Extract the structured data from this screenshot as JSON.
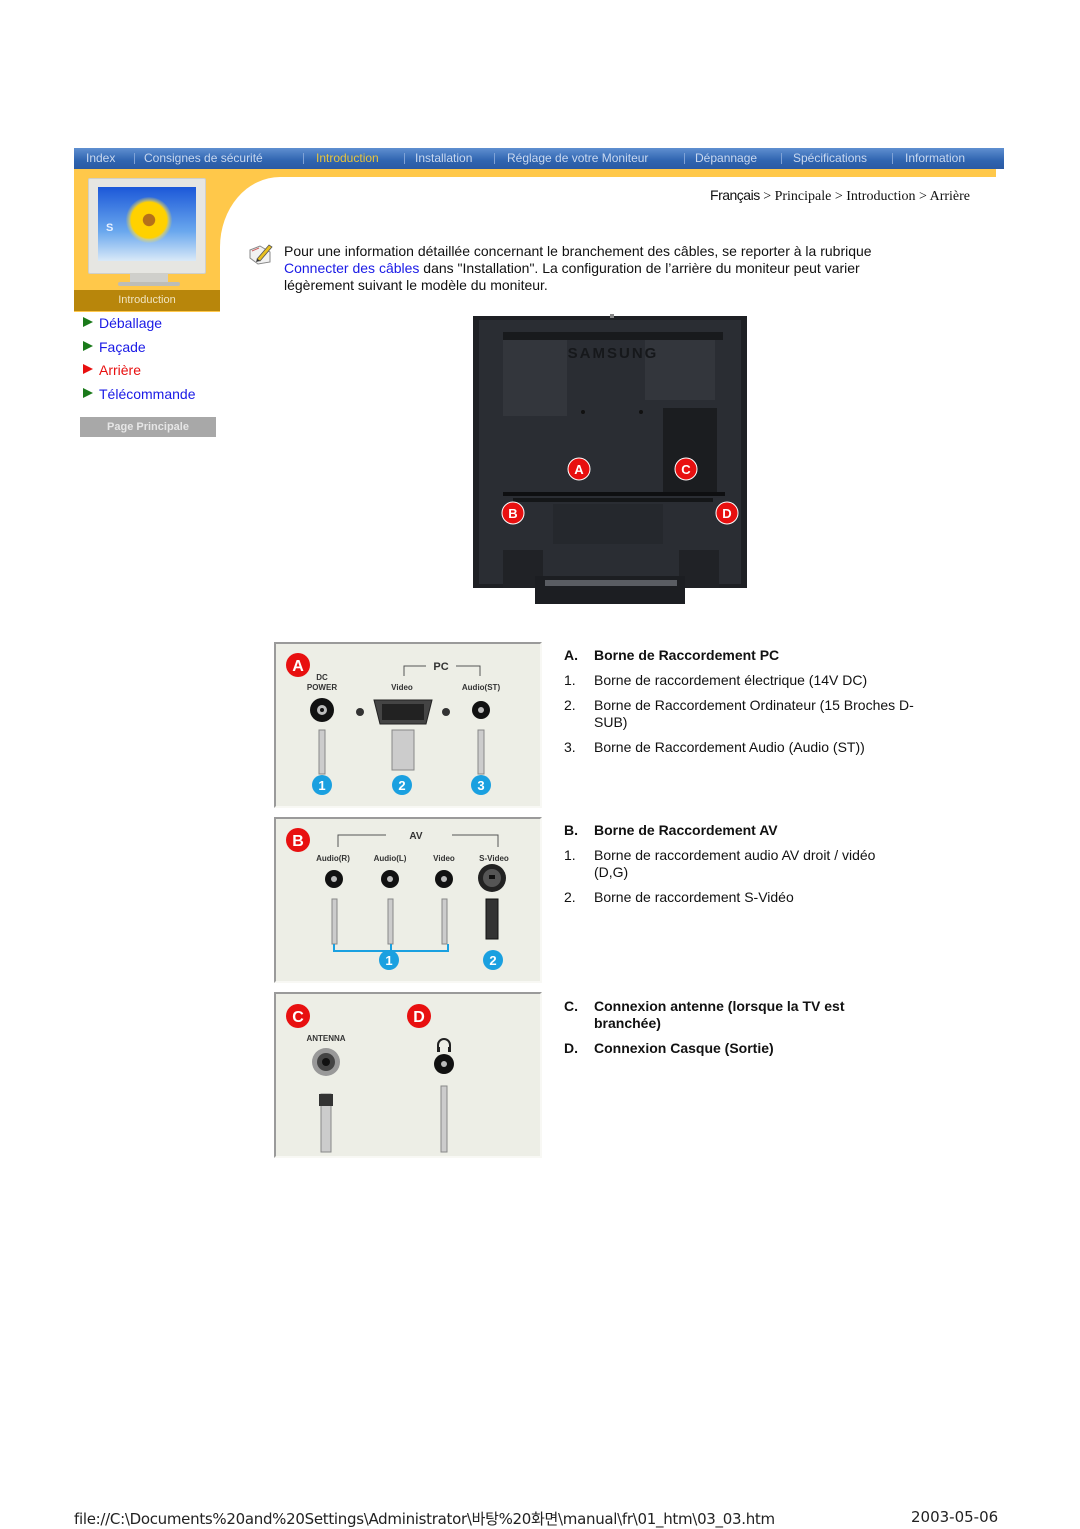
{
  "nav": {
    "items": [
      {
        "label": "Index",
        "active": false
      },
      {
        "label": "Consignes de sécurité",
        "active": false
      },
      {
        "label": "Introduction",
        "active": true
      },
      {
        "label": "Installation",
        "active": false
      },
      {
        "label": "Réglage de votre Moniteur",
        "active": false
      },
      {
        "label": "Dépannage",
        "active": false
      },
      {
        "label": "Spécifications",
        "active": false
      },
      {
        "label": "Information",
        "active": false
      }
    ],
    "colors": {
      "bar": "#2f64b0",
      "text": "#c9d8ef",
      "active_text": "#e8c43a",
      "strip": "#ffc84a"
    }
  },
  "sidebar": {
    "section_label": "Introduction",
    "monitor_screen_letter": "S",
    "items": [
      {
        "label": "Déballage",
        "active": false
      },
      {
        "label": "Façade",
        "active": false
      },
      {
        "label": "Arrière",
        "active": true
      },
      {
        "label": "Télécommande",
        "active": false
      }
    ],
    "home_button": "Page Principale"
  },
  "breadcrumb": {
    "first": "Français",
    "rest": " > Principale > Introduction > Arrière"
  },
  "note": {
    "icon": "note-pencil-icon",
    "text_before": "Pour une information détaillée concernant le branchement des câbles, se reporter à la rubrique ",
    "link": "Connecter des câbles",
    "text_after": " dans \"Installation\". La configuration de l’arrière du moniteur peut varier légèrement suivant le modèle du moniteur."
  },
  "rear_photo": {
    "brand": "SAMSUNG",
    "markers": [
      "A",
      "B",
      "C",
      "D"
    ]
  },
  "panels": {
    "a": {
      "badge": "A",
      "group": "PC",
      "labels": [
        "DC",
        "POWER",
        "Video",
        "Audio(ST)"
      ],
      "numbers": [
        "1",
        "2",
        "3"
      ]
    },
    "b": {
      "badge": "B",
      "group": "AV",
      "labels": [
        "Audio(R)",
        "Audio(L)",
        "Video",
        "S-Video"
      ],
      "numbers": [
        "1",
        "2"
      ]
    },
    "cd": {
      "badges": [
        "C",
        "D"
      ],
      "labels": [
        "ANTENNA"
      ]
    }
  },
  "sections": [
    {
      "letter": "A.",
      "title": "Borne de Raccordement PC",
      "items": [
        {
          "num": "1.",
          "text": "Borne de raccordement électrique (14V DC)"
        },
        {
          "num": "2.",
          "text": "Borne de Raccordement Ordinateur (15 Broches D-SUB)"
        },
        {
          "num": "3.",
          "text": "Borne de Raccordement Audio (Audio (ST))"
        }
      ]
    },
    {
      "letter": "B.",
      "title": "Borne de Raccordement AV",
      "items": [
        {
          "num": "1.",
          "text": "Borne de raccordement audio AV droit / vidéo (D,G)"
        },
        {
          "num": "2.",
          "text": "Borne de raccordement S-Vidéo"
        }
      ]
    },
    {
      "letter": "C.",
      "title": "Connexion antenne (lorsque la TV est branchée)"
    },
    {
      "letter": "D.",
      "title": "Connexion Casque (Sortie)"
    }
  ],
  "footer": {
    "path": "file://C:\\Documents%20and%20Settings\\Administrator\\바탕%20화면\\manual\\fr\\01_htm\\03_03.htm",
    "date": "2003-05-06"
  },
  "colors": {
    "link": "#1a1ae6",
    "active_link": "#e81010",
    "badge_red": "#e81010",
    "badge_blue": "#1aa0e0"
  }
}
